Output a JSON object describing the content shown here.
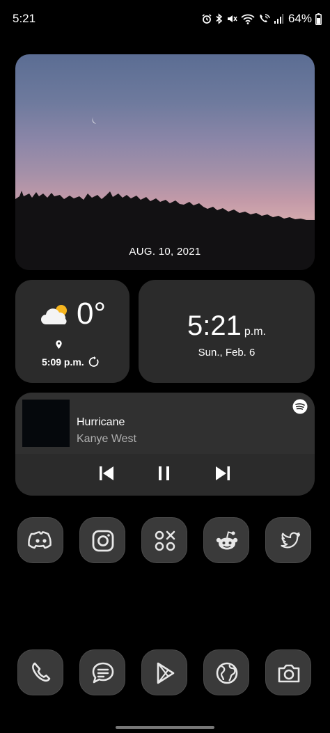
{
  "status_bar": {
    "time": "5:21",
    "battery_percent": "64%",
    "icons": [
      "alarm-icon",
      "bluetooth-icon",
      "mute-icon",
      "wifi-icon",
      "wifi-calling-icon",
      "signal-icon",
      "battery-icon"
    ]
  },
  "photo_widget": {
    "date": "AUG. 10, 2021"
  },
  "weather_widget": {
    "temperature": "0°",
    "updated_time": "5:09 p.m.",
    "icons": [
      "partly-cloudy-icon",
      "location-pin-icon",
      "refresh-icon"
    ]
  },
  "clock_widget": {
    "time": "5:21",
    "ampm": "p.m.",
    "date": "Sun., Feb. 6"
  },
  "media_widget": {
    "title": "Hurricane",
    "artist": "Kanye West",
    "source_icon": "spotify-icon",
    "controls": [
      "previous-icon",
      "pause-icon",
      "next-icon"
    ]
  },
  "apps_row": [
    "discord-icon",
    "instagram-icon",
    "games-icon",
    "reddit-icon",
    "twitter-icon"
  ],
  "dock": [
    "phone-icon",
    "messages-icon",
    "play-store-icon",
    "browser-icon",
    "camera-icon"
  ],
  "colors": {
    "widget_bg": "#2b2b2b",
    "app_icon_bg": "#3a3a3a",
    "muted_text": "#b0b0b0"
  }
}
